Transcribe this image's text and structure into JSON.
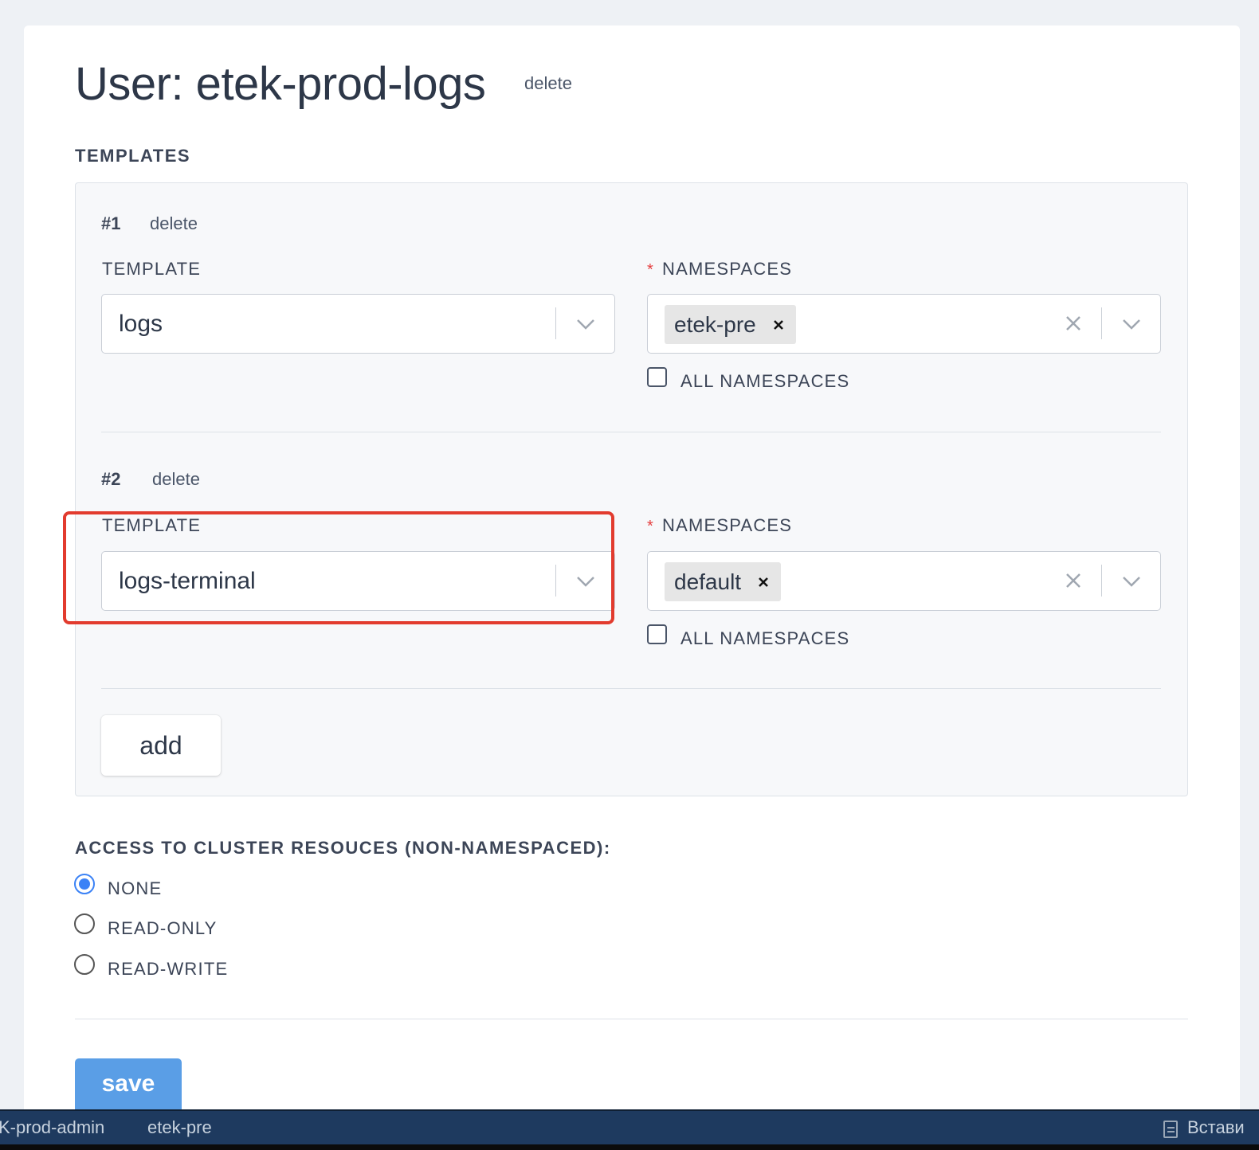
{
  "header": {
    "title": "User: etek-prod-logs",
    "delete_label": "delete"
  },
  "templates_section": {
    "heading": "TEMPLATES",
    "items": [
      {
        "number": "#1",
        "delete_label": "delete",
        "template_label": "TEMPLATE",
        "template_value": "logs",
        "namespaces_required": "*",
        "namespaces_label": "NAMESPACES",
        "namespace_chip": "etek-pre",
        "all_namespaces_label": "ALL NAMESPACES",
        "all_namespaces_checked": false
      },
      {
        "number": "#2",
        "delete_label": "delete",
        "template_label": "TEMPLATE",
        "template_value": "logs-terminal",
        "namespaces_required": "*",
        "namespaces_label": "NAMESPACES",
        "namespace_chip": "default",
        "all_namespaces_label": "ALL NAMESPACES",
        "all_namespaces_checked": false
      }
    ],
    "add_label": "add"
  },
  "cluster_access": {
    "heading": "ACCESS TO CLUSTER RESOUCES (NON-NAMESPACED):",
    "options": [
      {
        "label": "NONE",
        "selected": true
      },
      {
        "label": "READ-ONLY",
        "selected": false
      },
      {
        "label": "READ-WRITE",
        "selected": false
      }
    ]
  },
  "save_label": "save",
  "taskbar": {
    "items": [
      "K-prod-admin",
      "etek-pre"
    ],
    "right_label": "Встави"
  },
  "colors": {
    "highlight": "#e23b2e",
    "radio_selected": "#3b82f6",
    "save_button": "#5a9ee6",
    "required_asterisk": "#e53e3e",
    "taskbar": "#1e3a5f"
  },
  "icons": {
    "select_chevron": "chevron-down-icon",
    "clear": "clear-icon",
    "chip_remove": "chip-remove-icon",
    "taskbar_doc": "document-icon"
  }
}
